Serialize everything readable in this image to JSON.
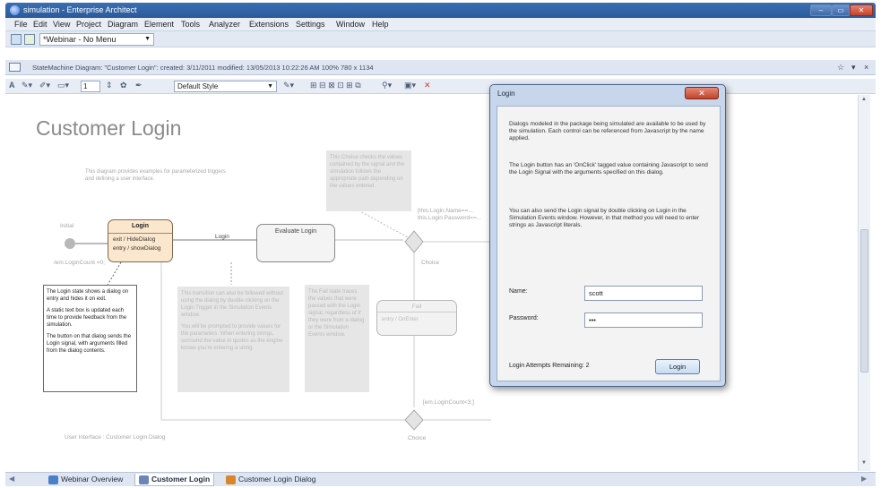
{
  "window": {
    "title": "simulation - Enterprise Architect",
    "controls": [
      "–",
      "▭",
      "✕"
    ]
  },
  "menu": [
    "File",
    "Edit",
    "View",
    "Project",
    "Diagram",
    "Element",
    "Tools",
    "Analyzer",
    "Extensions",
    "Settings",
    "Window",
    "Help"
  ],
  "workspace": {
    "value": "*Webinar - No Menu"
  },
  "doc_info": "StateMachine Diagram: \"Customer Login\":  created: 3/11/2011  modified: 13/05/2013 10:22:26 AM   100%   780 x 1134",
  "style_dropdown": "Default Style",
  "line_width": "1",
  "diagram": {
    "title": "Customer Login",
    "intro": "This diagram provides examples for parameterized triggers and defining a user interface.",
    "initial_label": "Initial",
    "initial_effect": "/em.LoginCount =0;",
    "login_state": {
      "name": "Login",
      "exit": "exit / HideDialog",
      "entry": "entry / showDialog"
    },
    "transition_login": "Login",
    "evaluate_state": "Evaluate Login",
    "choice_note": "This Choice checks the values contained by the signal and the simulation follows the appropriate path depending on the values entered.",
    "choice_guard": "[this.Login.Name==...  this.Login.Password==...",
    "choice_label": "Choice",
    "choice2_label": "Choice",
    "fail_state": {
      "name": "Fail",
      "body": "entry / OnEnter"
    },
    "login_note": [
      "The Login state shows a dialog on entry and hides it on exit.",
      "A static text box is updated each time to provide feedback from the simulation.",
      "The button on that dialog sends the Login signal, with arguments filled from the dialog contents."
    ],
    "trigger_note": [
      "This transition can also be followed without using the dialog by double clicking on the Login Trigger in the Simulation Events window.",
      "You will be prompted to provide values for the parameters. When entering strings, surround the value in quotes as the engine knows you're entering a string."
    ],
    "fail_note": "The Fail state traces the values that were passed with the Login signal, regardless of if they were from a dialog or the Simulation Events window.",
    "retry_guard": "[em.LoginCount<3;]",
    "ui_label": "User Interface : Customer Login Dialog"
  },
  "dialog": {
    "title": "Login",
    "close": "✕",
    "para1": "Dialogs modeled in the package being simulated are available to be used by the simulation. Each control can be referenced from Javascript by the name applied.",
    "para2": "The Login button has an 'OnClick' tagged value containing Javascript to send the Login Signal with the arguments specified on this dialog.",
    "para3": "You can also send the Login signal by double clicking on Login in the Simulation Events window. However, in that method you will need to enter strings as Javascript literals.",
    "name_label": "Name:",
    "name_value": "scott",
    "password_label": "Password:",
    "password_value": "•••",
    "attempts": "Login Attempts Remaining: 2",
    "login_button": "Login"
  },
  "tabs": [
    {
      "label": "Webinar Overview",
      "icon_color": "#4a7fc9"
    },
    {
      "label": "Customer Login",
      "icon_color": "#6a86b8"
    },
    {
      "label": "Customer Login Dialog",
      "icon_color": "#d9862b"
    }
  ]
}
